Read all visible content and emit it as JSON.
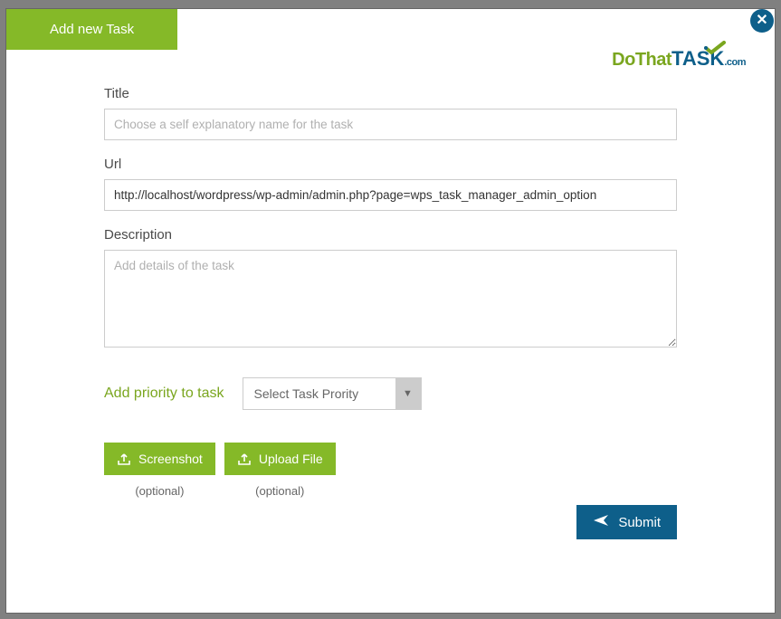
{
  "header": {
    "tab_label": "Add new Task",
    "logo": {
      "do": "Do",
      "that": "That",
      "task": "TASK",
      "com": ".com"
    }
  },
  "form": {
    "title": {
      "label": "Title",
      "placeholder": "Choose a self explanatory name for the task",
      "value": ""
    },
    "url": {
      "label": "Url",
      "value": "http://localhost/wordpress/wp-admin/admin.php?page=wps_task_manager_admin_option"
    },
    "description": {
      "label": "Description",
      "placeholder": "Add details of the task",
      "value": ""
    },
    "priority": {
      "label": "Add priority to task",
      "selected": "Select Task Prority"
    },
    "screenshot": {
      "label": "Screenshot",
      "optional": "(optional)"
    },
    "upload": {
      "label": "Upload File",
      "optional": "(optional)"
    },
    "submit": {
      "label": "Submit"
    }
  }
}
